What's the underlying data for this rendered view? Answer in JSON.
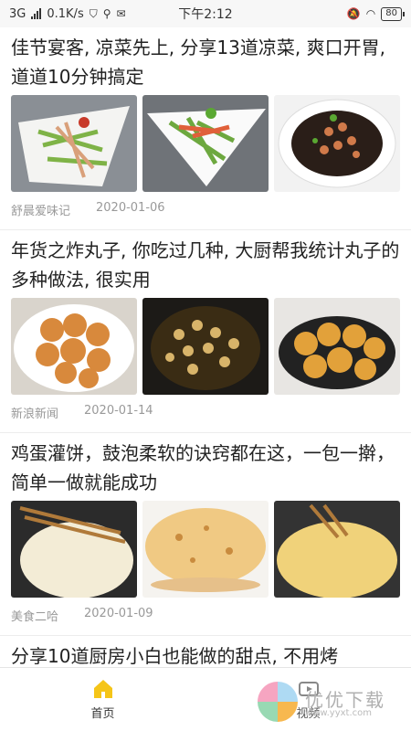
{
  "status_bar": {
    "network": "3G",
    "speed": "0.1K/s",
    "time": "下午2:12",
    "battery": "80"
  },
  "articles": [
    {
      "title": "佳节宴客, 凉菜先上, 分享13道凉菜, 爽口开胃, 道道10分钟搞定",
      "source": "舒晨爱味记",
      "date": "2020-01-06"
    },
    {
      "title": "年货之炸丸子, 你吃过几种, 大厨帮我统计丸子的多种做法, 很实用",
      "source": "新浪新闻",
      "date": "2020-01-14"
    },
    {
      "title": "鸡蛋灌饼，鼓泡柔软的诀窍都在这，一包一擀，简单一做就能成功",
      "source": "美食二哈",
      "date": "2020-01-09"
    },
    {
      "title": "分享10道厨房小白也能做的甜点, 不用烤",
      "source": "",
      "date": ""
    }
  ],
  "tab_bar": {
    "home_label": "首页",
    "video_label": "视频",
    "home_icon": "home-icon",
    "video_icon": "video-icon"
  },
  "watermark": {
    "text": "优优下载",
    "url": "www.yyxt.com"
  },
  "colors": {
    "accent_home": "#f5c518",
    "meta_gray": "#999999"
  }
}
